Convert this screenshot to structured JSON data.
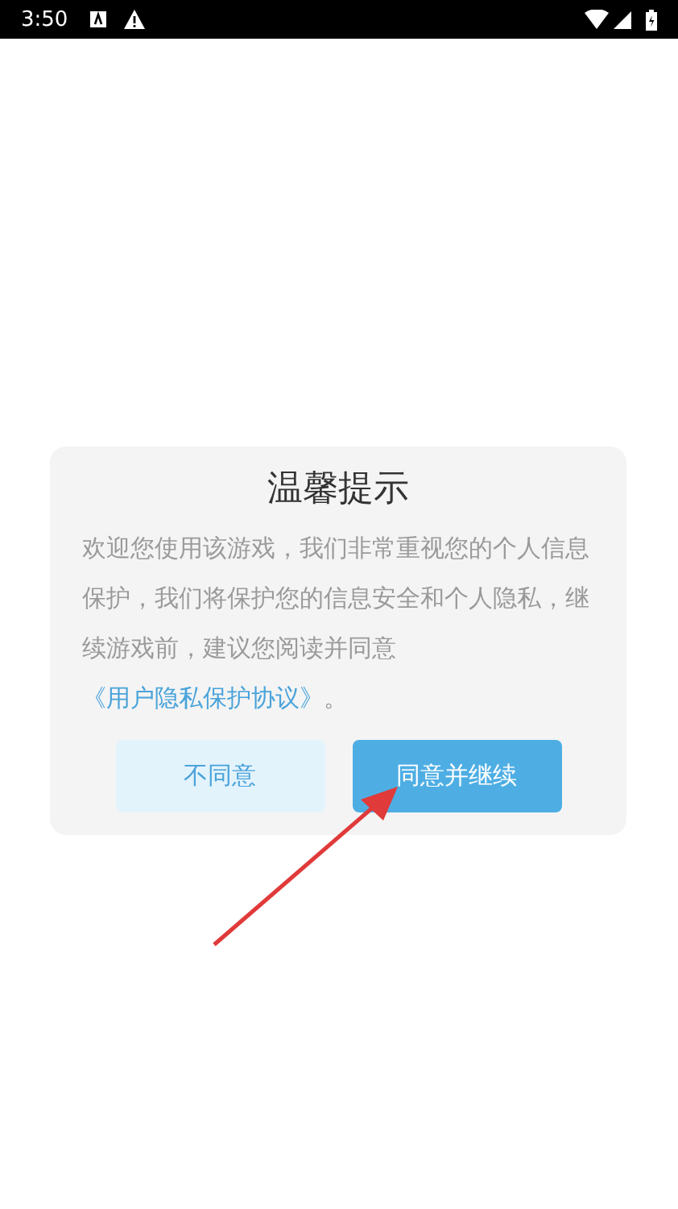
{
  "status_bar": {
    "time": "3:50"
  },
  "dialog": {
    "title": "温馨提示",
    "message": {
      "text": "欢迎您使用该游戏，我们非常重视您的个人信息保护，我们将保护您的信息安全和个人隐私，继续游戏前，建议您阅读并同意",
      "link": "《用户隐私保护协议》",
      "tail": "。"
    },
    "buttons": [
      {
        "label": "不同意",
        "kind": "secondary"
      },
      {
        "label": "同意并继续",
        "kind": "primary"
      }
    ]
  }
}
